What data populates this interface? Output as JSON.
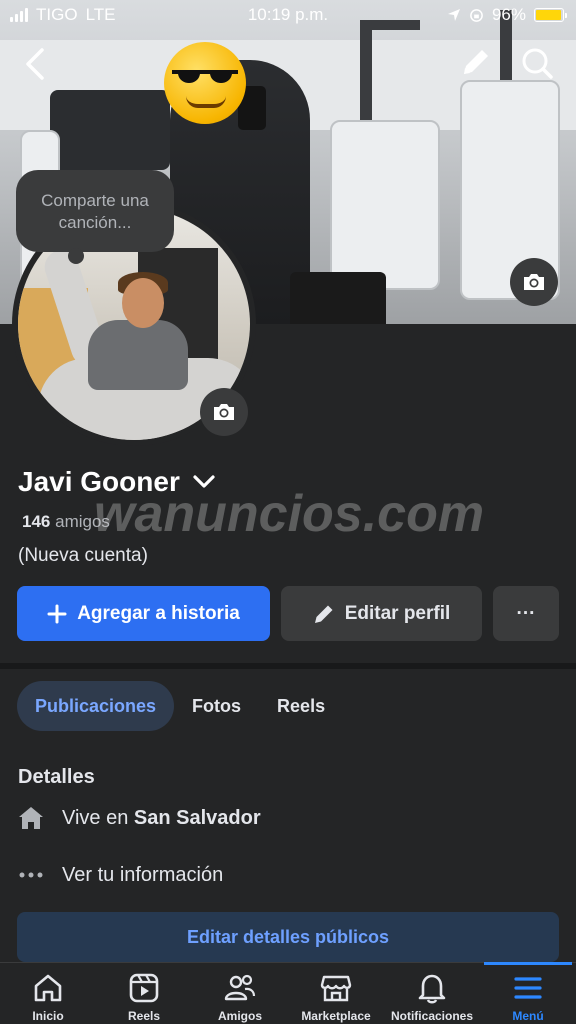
{
  "status_bar": {
    "carrier": "TIGO",
    "network": "LTE",
    "time": "10:19 p.m.",
    "battery": "96%",
    "battery_level": 0.96,
    "battery_color": "#ffd60a"
  },
  "profile": {
    "song_prompt": "Comparte una canción...",
    "name": "Javi Gooner",
    "friends_count": "146",
    "friends_label": "amigos",
    "bio": "(Nueva cuenta)"
  },
  "watermark": "wanuncios.com",
  "actions": {
    "add_story": "Agregar a historia",
    "edit_profile": "Editar perfil",
    "more": "···"
  },
  "tabs": [
    {
      "label": "Publicaciones",
      "active": true
    },
    {
      "label": "Fotos",
      "active": false
    },
    {
      "label": "Reels",
      "active": false
    }
  ],
  "details": {
    "title": "Detalles",
    "lives_in_prefix": "Vive en",
    "lives_in_city": "San Salvador",
    "see_info": "Ver tu información",
    "edit_public_details": "Editar detalles públicos"
  },
  "bottom_nav": [
    {
      "label": "Inicio",
      "icon": "home-icon",
      "active": false
    },
    {
      "label": "Reels",
      "icon": "reels-icon",
      "active": false
    },
    {
      "label": "Amigos",
      "icon": "friends-icon",
      "active": false
    },
    {
      "label": "Marketplace",
      "icon": "marketplace-icon",
      "active": false
    },
    {
      "label": "Notificaciones",
      "icon": "bell-icon",
      "active": false
    },
    {
      "label": "Menú",
      "icon": "menu-icon",
      "active": true
    }
  ],
  "colors": {
    "accent": "#2d6ff2",
    "active_nav": "#2d88ff",
    "background": "#242526"
  }
}
